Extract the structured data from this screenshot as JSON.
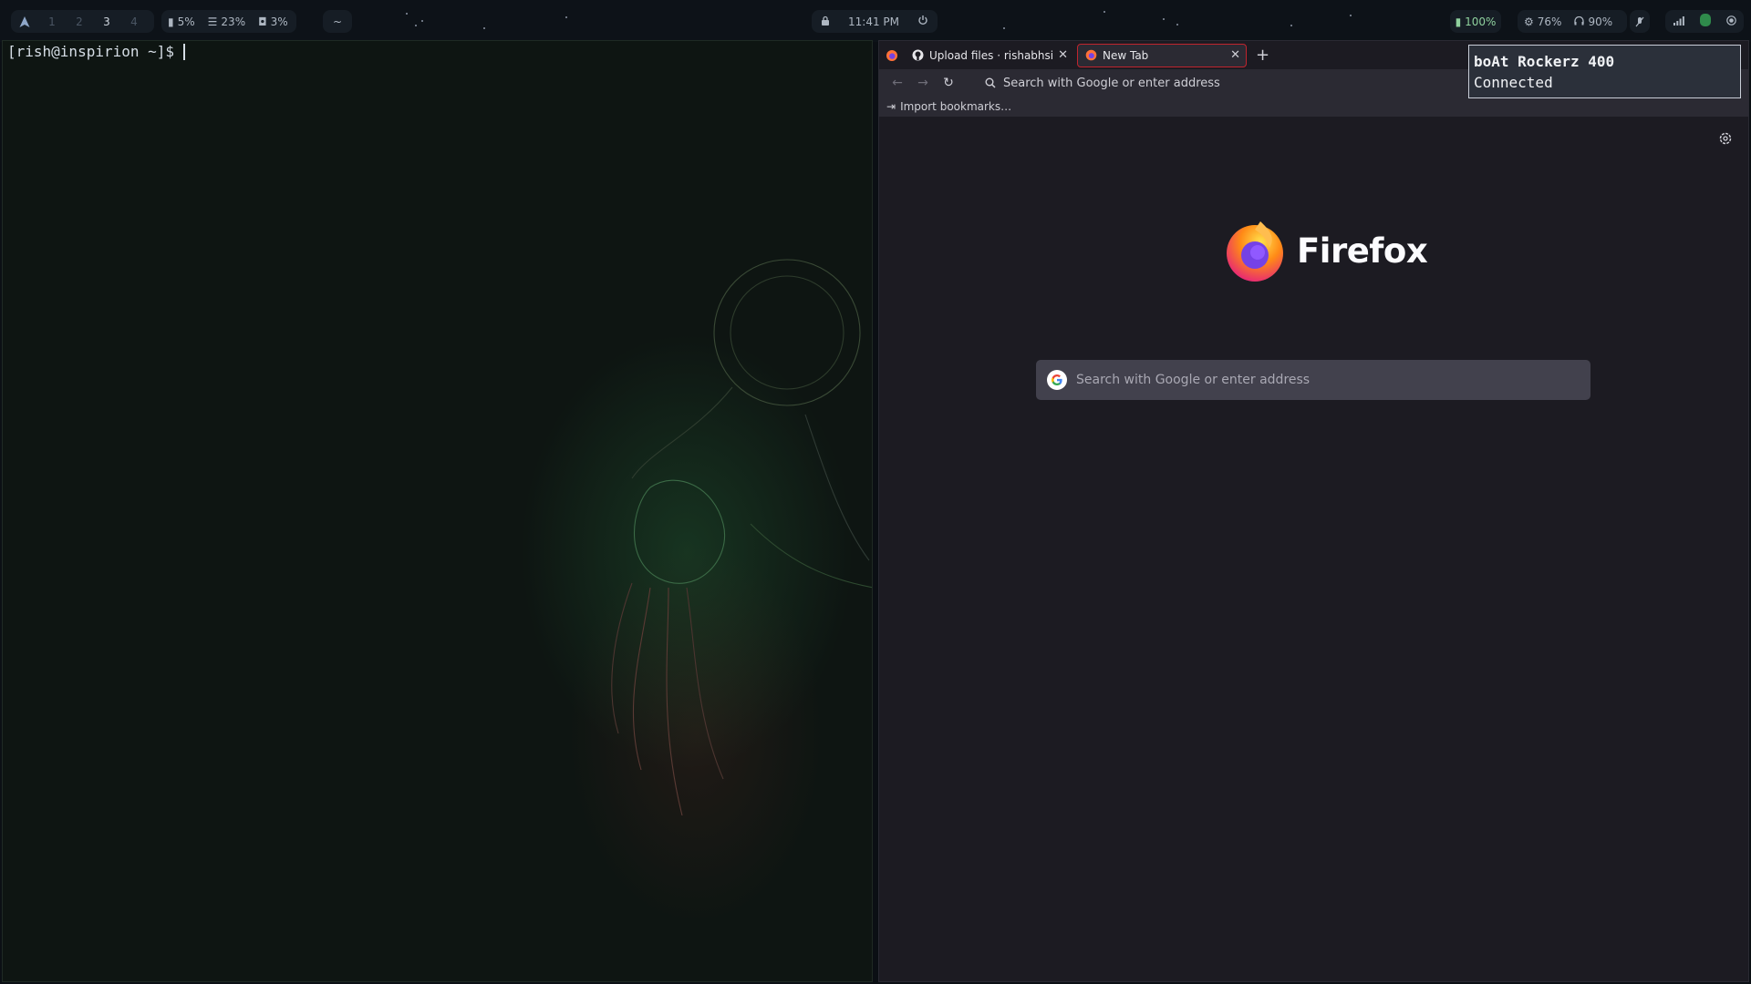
{
  "topbar": {
    "workspaces": [
      "1",
      "2",
      "3",
      "4"
    ],
    "active_workspace": "3",
    "cpu": "5%",
    "memory": "23%",
    "disk": "3%",
    "directory": "~",
    "clock": "11:41 PM",
    "battery": "100%",
    "brightness": "76%",
    "headset_battery": "90%"
  },
  "terminal": {
    "prompt": "[rish@inspirion ~]$"
  },
  "firefox": {
    "tabs": [
      {
        "label": "Upload files · rishabhsingh",
        "active": false
      },
      {
        "label": "New Tab",
        "active": true
      }
    ],
    "url_placeholder": "Search with Google or enter address",
    "import_bookmarks": "Import bookmarks…",
    "wordmark": "Firefox",
    "search_placeholder": "Search with Google or enter address"
  },
  "notification": {
    "title": "boAt Rockerz 400",
    "body": "Connected"
  },
  "colors": {
    "accent_tab_border": "#c0242e",
    "status_green": "#8fd19e"
  }
}
